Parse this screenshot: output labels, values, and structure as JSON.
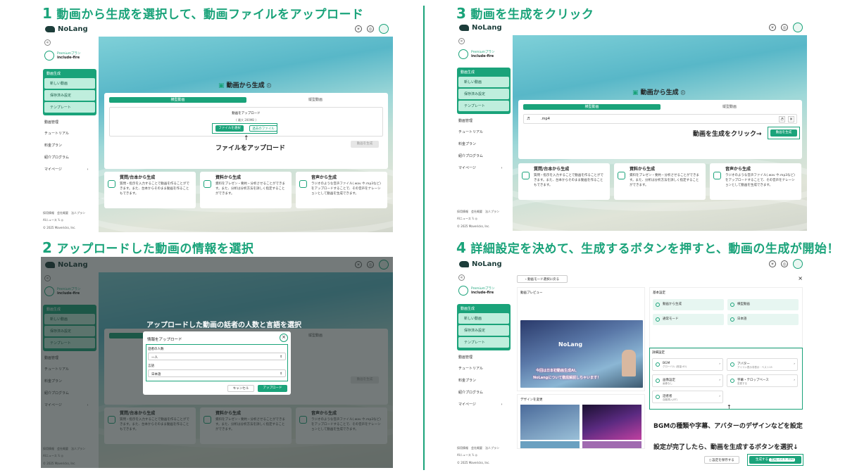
{
  "steps": [
    {
      "num": "1",
      "title": "動画から生成を選択して、動画ファイルをアップロード"
    },
    {
      "num": "2",
      "title": "アップロードした動画の情報を選択"
    },
    {
      "num": "3",
      "title": "動画を生成をクリック"
    },
    {
      "num": "4",
      "title": "詳細設定を決めて、生成するボタンを押すと、動画の生成が開始！"
    }
  ],
  "app": {
    "logo": "NoLang",
    "collapse": "«",
    "plan_label": "Premiumプラン",
    "user": "include-fire",
    "gen_header": "動画生成",
    "gen_items": [
      "新しい動画",
      "保存済み設定",
      "テンプレート"
    ],
    "nav": [
      "動画管理",
      "チュートリアル",
      "料金プラン",
      "紹介プログラム",
      "マイページ"
    ],
    "nav_arrow": "›",
    "footer_links": "採用情報　会社概要　法人プラン",
    "footer_ai": "AIニュース",
    "footer_x": "𝕏",
    "footer_ig": "◎",
    "copyright": "© 2025 Mavericks, Inc."
  },
  "gen_page": {
    "heading": "動画から生成",
    "tab_landscape": "横型動画",
    "tab_portrait": "縦型動画",
    "upload_label": "動画をアップロード",
    "max_size": "( 最大 200MB )",
    "choose_file": "ファイルを選択",
    "past_file": "過去のファイル",
    "generate": "動画を生成",
    "filename": ".mp4",
    "cards": [
      {
        "title": "質問/台本から生成",
        "desc": "質問・指示を入力することで動画を作ることができます。また、台本からそのまま動画を作ることもできます。"
      },
      {
        "title": "資料から生成",
        "desc": "資料をプレゼン・要約・分析させることができます。また、分析は分析方法を詳しく指定することができます。"
      },
      {
        "title": "音声から生成",
        "desc": "ラジオのような音声ファイル(.wav や.mp3など)をアップロードすることで、その音声をナレーションとして動画を生成できます。"
      }
    ]
  },
  "annotations": {
    "p1": "ファイルをアップロード",
    "p1_arrow": "↑",
    "p2": "アップロードした動画の話者の人数と言語を選択",
    "p3": "動画を生成をクリック→",
    "p4_arrow": "↑",
    "p4a": "BGMの種類や字幕、アバターのデザインなどを設定",
    "p4b": "設定が完了したら、動画を生成するボタンを選択↓"
  },
  "modal": {
    "title": "情報をアップロード",
    "close": "×",
    "speakers_label": "話者の人数",
    "speakers_value": "一人",
    "language_label": "言語",
    "language_value": "日本語",
    "caret": "⇕",
    "cancel": "キャンセル",
    "upload": "アップロード"
  },
  "settings": {
    "back": "動画モード選択に戻る",
    "close": "×",
    "preview": "動画プレビュー",
    "preview_logo": "NoLang",
    "preview_caption1": "今回は日本初動画生成AI、",
    "preview_caption2": "NoLangについて徹底解説しちゃいます！",
    "design_change": "デザインを変更",
    "basic": "基本設定",
    "basic_items": [
      "動画から生成",
      "横型動画",
      "通常モード",
      "日本語"
    ],
    "detail": "詳細設定",
    "bgm": "BGM",
    "bgm_sub": "グローバル (音量:40)",
    "avatar": "アバター",
    "avatar_sub": "アイコン表示非表示 · ベスト15",
    "image": "画像設定",
    "image_sub": "画像なし",
    "caption": "字幕・テロップベース",
    "caption_sub": "変更する",
    "voice": "話者者",
    "voice_sub": "自動挿入(BT)",
    "chev": "›",
    "save": "設定を保存する",
    "generate": "生成する",
    "cost": "生成コスト 450"
  }
}
